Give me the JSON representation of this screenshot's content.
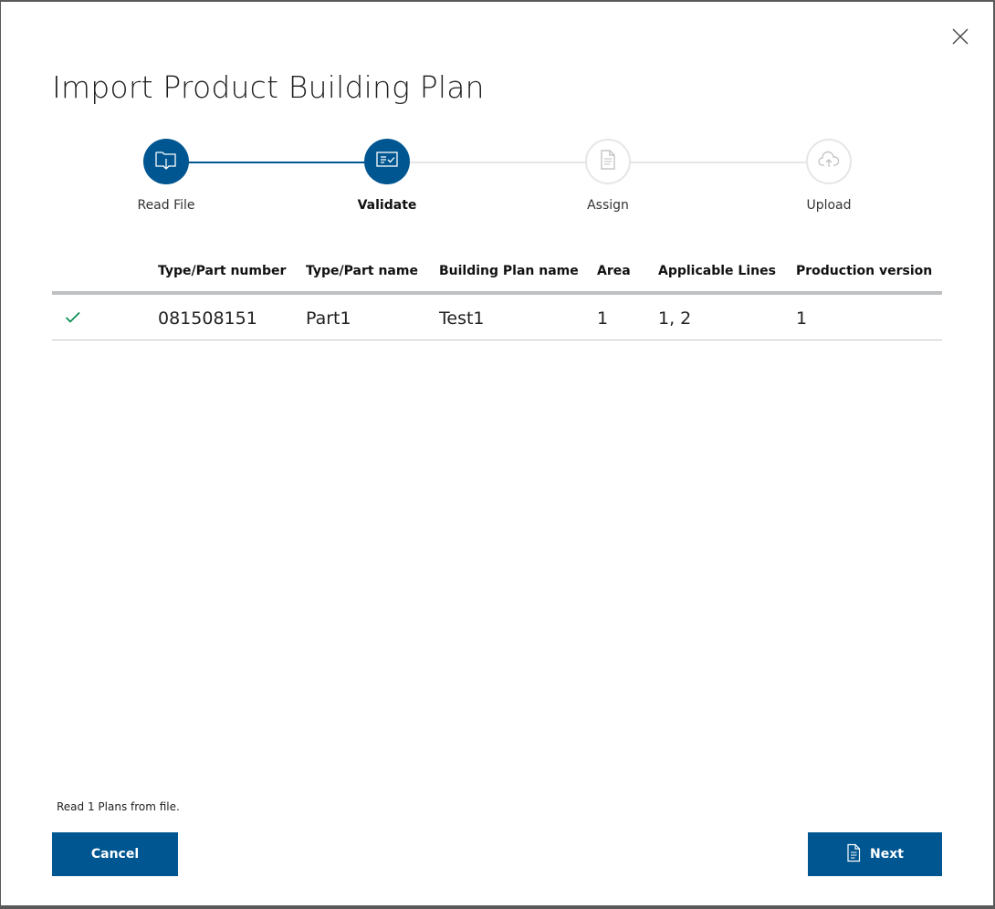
{
  "dialog": {
    "title": "Import Product Building Plan",
    "close_icon": "close-icon"
  },
  "stepper": {
    "steps": [
      {
        "label": "Read File",
        "icon": "folder-download-icon",
        "state": "done"
      },
      {
        "label": "Validate",
        "icon": "validate-list-icon",
        "state": "active"
      },
      {
        "label": "Assign",
        "icon": "document-icon",
        "state": "todo"
      },
      {
        "label": "Upload",
        "icon": "cloud-upload-icon",
        "state": "todo"
      }
    ]
  },
  "table": {
    "columns": [
      "Type/Part number",
      "Type/Part name",
      "Building Plan name",
      "Area",
      "Applicable Lines",
      "Production version"
    ],
    "rows": [
      {
        "status_icon": "checkmark-icon",
        "part_number": "081508151",
        "part_name": "Part1",
        "plan_name": "Test1",
        "area": "1",
        "lines": "1, 2",
        "production_version": "1"
      }
    ]
  },
  "footer": {
    "status_text": "Read 1 Plans from file.",
    "cancel_label": "Cancel",
    "next_label": "Next",
    "next_icon": "document-icon"
  },
  "colors": {
    "primary": "#005691",
    "success": "#00884a",
    "step_inactive": "#e6e6e6"
  }
}
